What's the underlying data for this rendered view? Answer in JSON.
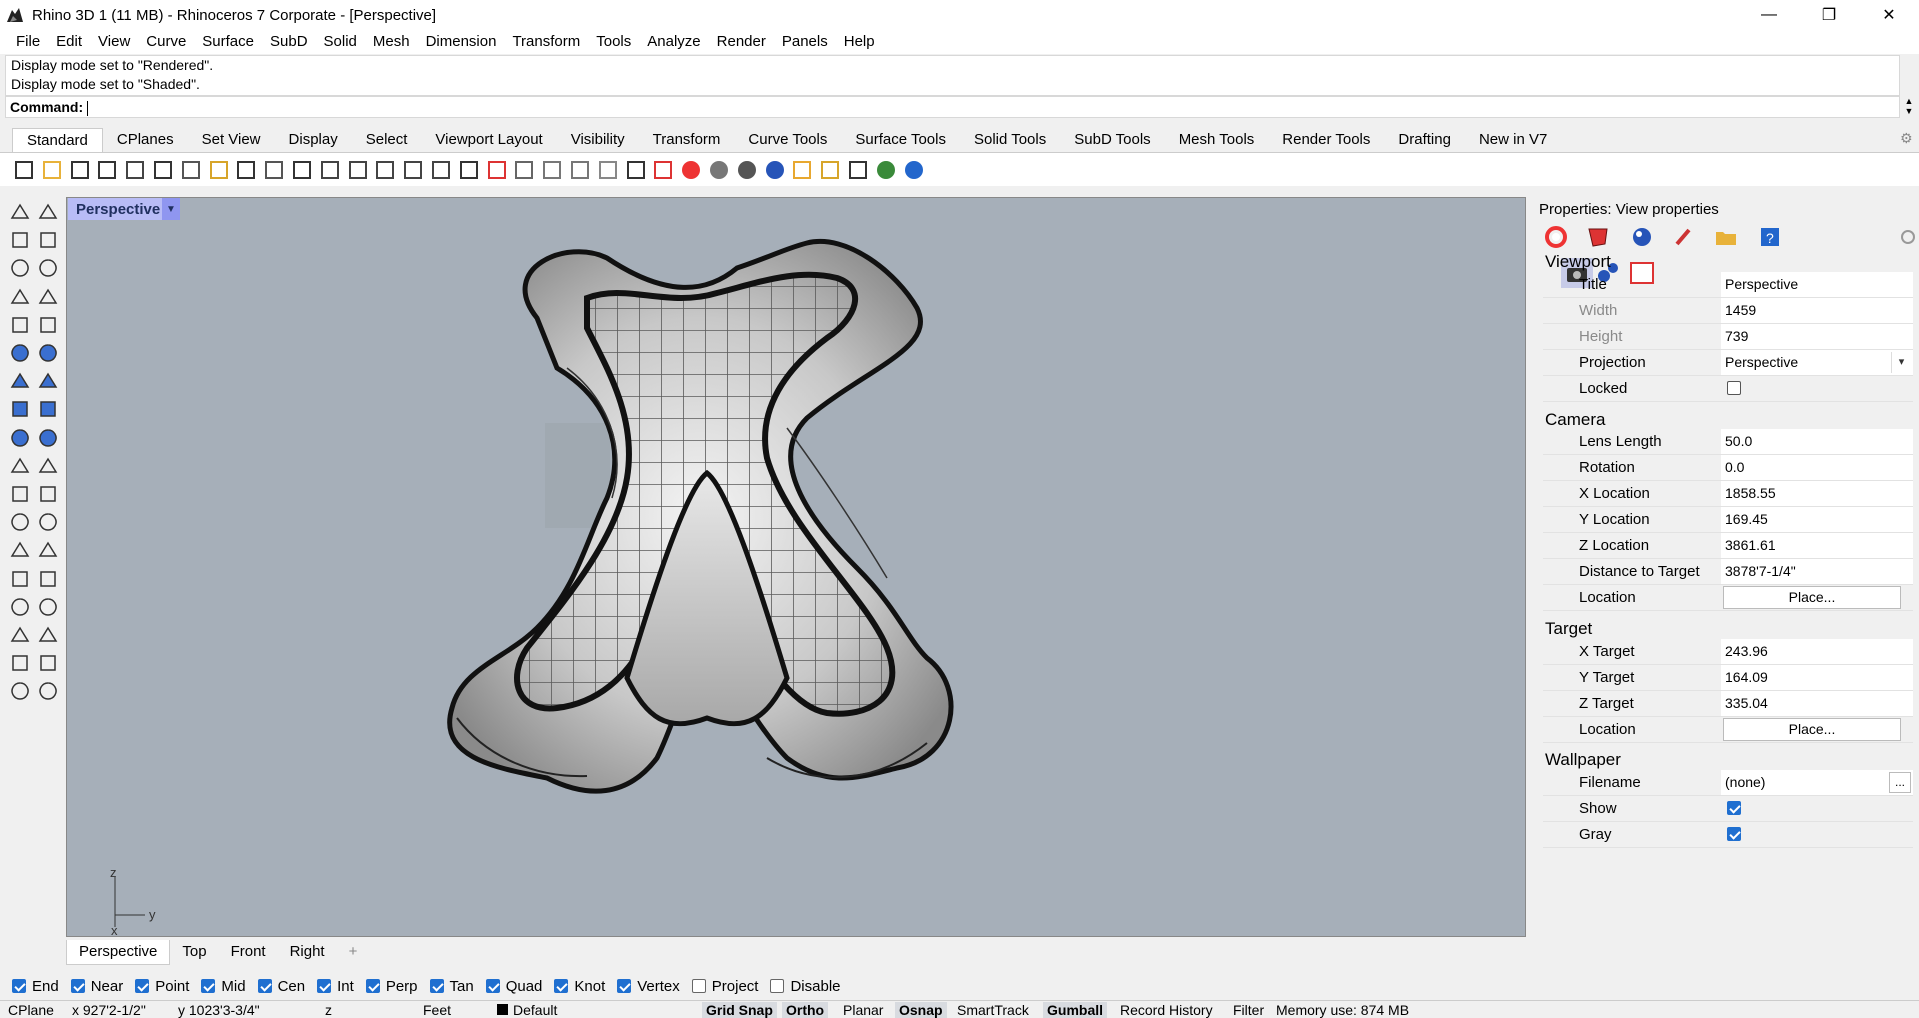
{
  "window": {
    "title": "Rhino 3D 1 (11 MB) - Rhinoceros 7 Corporate - [Perspective]",
    "minimize": "—",
    "maximize": "❐",
    "close": "✕"
  },
  "menu": [
    "File",
    "Edit",
    "View",
    "Curve",
    "Surface",
    "SubD",
    "Solid",
    "Mesh",
    "Dimension",
    "Transform",
    "Tools",
    "Analyze",
    "Render",
    "Panels",
    "Help"
  ],
  "command": {
    "history": [
      "Display mode set to \"Rendered\".",
      "Display mode set to \"Shaded\"."
    ],
    "prompt": "Command:"
  },
  "toolbar_tabs": [
    "Standard",
    "CPlanes",
    "Set View",
    "Display",
    "Select",
    "Viewport Layout",
    "Visibility",
    "Transform",
    "Curve Tools",
    "Surface Tools",
    "Solid Tools",
    "SubD Tools",
    "Mesh Tools",
    "Render Tools",
    "Drafting",
    "New in V7"
  ],
  "active_toolbar_tab": "Standard",
  "toolbar_icons": [
    "new-icon",
    "open-icon",
    "save-icon",
    "print-icon",
    "import-icon",
    "cut-icon",
    "copy-icon",
    "paste-icon",
    "undo-icon",
    "pan-icon",
    "move-icon",
    "zoom-icon",
    "zoom-window-icon",
    "zoom-extents-icon",
    "zoom-selected-icon",
    "rotate-view-icon",
    "four-viewports-icon",
    "car-icon",
    "render-preview-icon",
    "snapshot-icon",
    "settings-icon",
    "lightbulb-icon",
    "lock-icon",
    "layers-icon",
    "color-wheel-icon",
    "material-sphere-icon",
    "shaded-sphere-icon",
    "rendered-sphere-icon",
    "brush-icon",
    "gears-icon",
    "dimension-icon",
    "globe-icon",
    "help-icon"
  ],
  "viewport": {
    "name": "Perspective",
    "axis_z": "z",
    "axis_y": "y",
    "axis_x": "x"
  },
  "viewport_tabs": [
    "Perspective",
    "Top",
    "Front",
    "Right"
  ],
  "viewport_tab_add": "+",
  "properties": {
    "title": "Properties: View properties",
    "viewport_section": "Viewport",
    "camera_section": "Camera",
    "target_section": "Target",
    "wallpaper_section": "Wallpaper",
    "viewport": {
      "title_label": "Title",
      "title_value": "Perspective",
      "width_label": "Width",
      "width_value": "1459",
      "height_label": "Height",
      "height_value": "739",
      "projection_label": "Projection",
      "projection_value": "Perspective",
      "locked_label": "Locked",
      "locked": false
    },
    "camera": {
      "lens_label": "Lens Length",
      "lens_value": "50.0",
      "rotation_label": "Rotation",
      "rotation_value": "0.0",
      "xloc_label": "X Location",
      "xloc_value": "1858.55",
      "yloc_label": "Y Location",
      "yloc_value": "169.45",
      "zloc_label": "Z Location",
      "zloc_value": "3861.61",
      "dist_label": "Distance to Target",
      "dist_value": "3878'7-1/4\"",
      "location_label": "Location",
      "place_label": "Place..."
    },
    "target": {
      "xt_label": "X Target",
      "xt_value": "243.96",
      "yt_label": "Y Target",
      "yt_value": "164.09",
      "zt_label": "Z Target",
      "zt_value": "335.04",
      "location_label": "Location",
      "place_label": "Place..."
    },
    "wallpaper": {
      "filename_label": "Filename",
      "filename_value": "(none)",
      "browse": "...",
      "show_label": "Show",
      "show": true,
      "gray_label": "Gray",
      "gray": true
    }
  },
  "osnaps": [
    {
      "label": "End",
      "on": true
    },
    {
      "label": "Near",
      "on": true
    },
    {
      "label": "Point",
      "on": true
    },
    {
      "label": "Mid",
      "on": true
    },
    {
      "label": "Cen",
      "on": true
    },
    {
      "label": "Int",
      "on": true
    },
    {
      "label": "Perp",
      "on": true
    },
    {
      "label": "Tan",
      "on": true
    },
    {
      "label": "Quad",
      "on": true
    },
    {
      "label": "Knot",
      "on": true
    },
    {
      "label": "Vertex",
      "on": true
    },
    {
      "label": "Project",
      "on": false
    },
    {
      "label": "Disable",
      "on": false
    }
  ],
  "status": {
    "cplane": "CPlane",
    "x": "x 927'2-1/2\"",
    "y": "y 1023'3-3/4\"",
    "z": "z",
    "units": "Feet",
    "layer": "Default",
    "grid_snap": "Grid Snap",
    "ortho": "Ortho",
    "planar": "Planar",
    "osnap": "Osnap",
    "smarttrack": "SmartTrack",
    "gumball": "Gumball",
    "record_history": "Record History",
    "filter": "Filter",
    "memory": "Memory use: 874 MB"
  }
}
